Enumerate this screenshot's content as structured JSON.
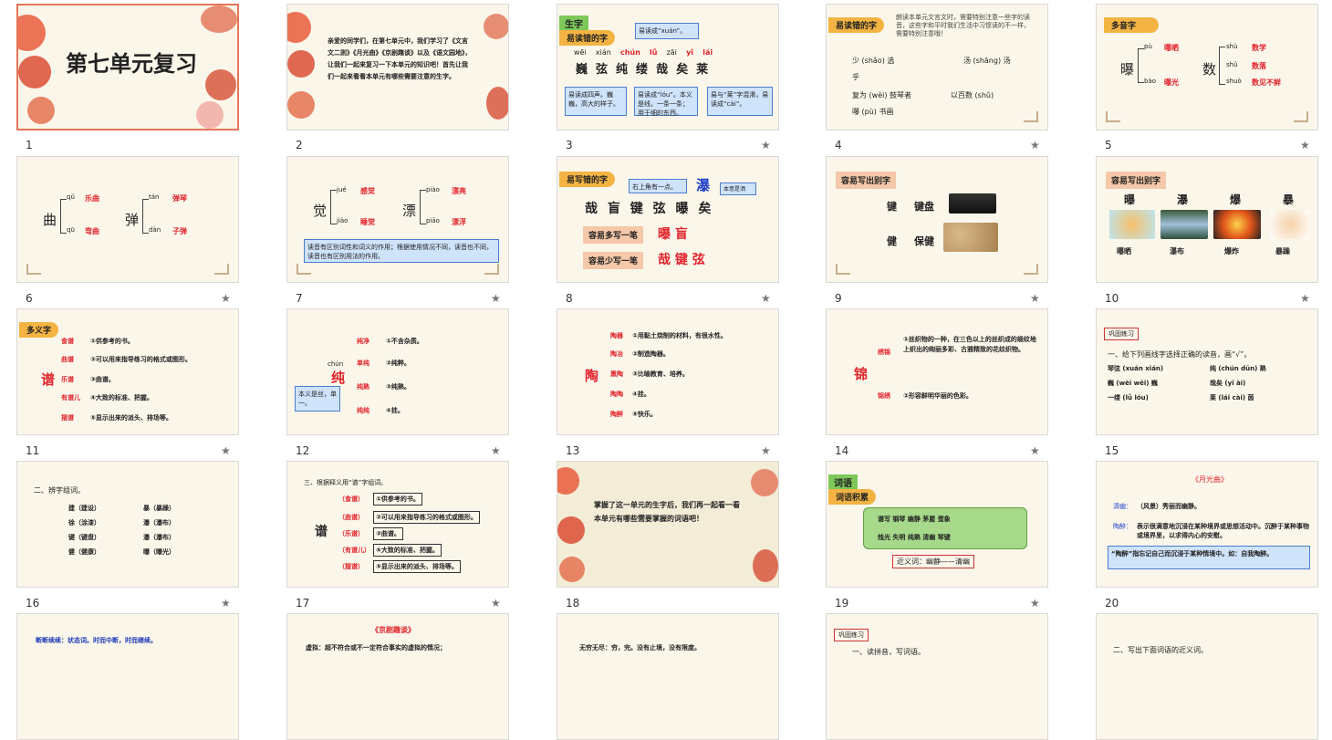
{
  "slides": {
    "s1": {
      "num": "1",
      "title": "第七单元复习"
    },
    "s2": {
      "num": "2",
      "text": "亲爱的同学们，在第七单元中，我们学习了《文言文二则》《月光曲》《京剧趣谈》以及《语文园地》，让我们一起来复习一下本单元的知识吧！首先让我们一起来看看本单元有哪些需要注意的生字。"
    },
    "s3": {
      "num": "3",
      "tag_main": "生字",
      "tag": "易读错的字",
      "callout_top": "易读成“xuán”。",
      "pinyin": [
        "wēi",
        "xián",
        "chún",
        "lǚ",
        "zāi",
        "yǐ",
        "lái"
      ],
      "chars": [
        "巍",
        "弦",
        "纯",
        "缕",
        "哉",
        "矣",
        "莱"
      ],
      "note1": "易读成四声。巍巍，高大的样子。",
      "note2": "易读成“lóu”。本义是线，一条一条；用于细的东西。",
      "note3": "易与“莱”字混淆，易读成“cài”。"
    },
    "s4": {
      "num": "4",
      "tag": "易读错的字",
      "intro": "朗读本单元文言文时，需要特别注意一些字的读音，这些字和平时我们生活中习惯读的不一样，需要特别注意哦！",
      "line1a": "少 (shǎo) 选",
      "line1b": "汤 (shāng) 汤",
      "line1c": "乎",
      "line2a": "复为 (wèi) 鼓琴者",
      "line2b": "以百数 (shǔ)",
      "line3": "曝 (pù) 书画"
    },
    "s5": {
      "num": "5",
      "tag": "多音字",
      "c1": "曝",
      "p1": "pù",
      "w1": "曝晒",
      "p2": "bào",
      "w2": "曝光",
      "c2": "数",
      "p3": "shù",
      "w3": "数学",
      "p4": "shǔ",
      "w4": "数落",
      "p5": "shuò",
      "w5": "数见不鲜"
    },
    "s6": {
      "num": "6",
      "c1": "曲",
      "p1": "qǔ",
      "w1": "乐曲",
      "p2": "qū",
      "w2": "弯曲",
      "c2": "弹",
      "p3": "tán",
      "w3": "弹琴",
      "p4": "dàn",
      "w4": "子弹"
    },
    "s7": {
      "num": "7",
      "c1": "觉",
      "p1": "jué",
      "w1": "感觉",
      "p2": "jiào",
      "w2": "睡觉",
      "c2": "漂",
      "p3": "piào",
      "w3": "漂亮",
      "p4": "piāo",
      "w4": "漂浮",
      "note": "读音有区别词性和词义的作用；根据使用情况不同，读音也不同，读音也有区别用法的作用。"
    },
    "s8": {
      "num": "8",
      "tag": "易写错的字",
      "callout": "右上角有一点。",
      "callout2": "本意是洒",
      "chars": "哉 盲 键 弦 曝 矣",
      "big": "瀑",
      "label1": "容易多写一笔",
      "ans1": "曝  盲",
      "label2": "容易少写一笔",
      "ans2": "哉  键  弦"
    },
    "s9": {
      "num": "9",
      "tag": "容易写出别字",
      "r1a": "键",
      "r1b": "键盘",
      "r2a": "健",
      "r2b": "保健"
    },
    "s10": {
      "num": "10",
      "tag": "容易写出别字",
      "chars": [
        "曝",
        "瀑",
        "爆",
        "暴"
      ],
      "words": [
        "曝晒",
        "瀑布",
        "爆炸",
        "暴躁"
      ]
    },
    "s11": {
      "num": "11",
      "tag": "多义字",
      "char": "谱",
      "items": [
        {
          "w": "食谱",
          "d": "①供参考的书。"
        },
        {
          "w": "曲谱",
          "d": "②可以用来指导练习的格式或图形。"
        },
        {
          "w": "乐谱",
          "d": "③曲谱。"
        },
        {
          "w": "有谱儿",
          "d": "④大致的标准、把握。"
        },
        {
          "w": "摆谱",
          "d": "⑤显示出来的派头、排场等。"
        }
      ]
    },
    "s12": {
      "num": "12",
      "char": "纯",
      "py": "chún",
      "note": "本义是丝，单一。",
      "items": [
        {
          "w": "纯净",
          "d": "①不含杂质。"
        },
        {
          "w": "单纯",
          "d": "②纯粹。"
        },
        {
          "w": "纯熟",
          "d": "③纯熟。"
        },
        {
          "w": "纯纯",
          "d": "④挂。"
        }
      ]
    },
    "s13": {
      "num": "13",
      "char": "陶",
      "items": [
        {
          "w": "陶器",
          "d": "①用黏土烧制的材料，有很水性。"
        },
        {
          "w": "陶冶",
          "d": "②制造陶器。"
        },
        {
          "w": "熏陶",
          "d": "③比喻教育、培养。"
        },
        {
          "w": "陶陶",
          "d": "④挂。"
        },
        {
          "w": "陶醉",
          "d": "⑤快乐。"
        }
      ]
    },
    "s14": {
      "num": "14",
      "char": "锦",
      "w1": "绣锦",
      "d1": "①丝织物的一种，在三色以上的丝织成的缎纹地上织出的绚丽多彩、古雅精致的花纹织物。",
      "w2": "锦绣",
      "d2": "②形容鲜明华丽的色彩。"
    },
    "s15": {
      "num": "15",
      "tag": "巩固练习",
      "q": "一、给下列画线字选择正确的读音，画“√”。",
      "l1a": "琴弦 (xuán xián)",
      "l1b": "纯 (chún dūn) 熟",
      "l2a": "巍 (wèi wēi) 巍",
      "l2b": "哉矣 (yǐ ài)",
      "l3a": "一缕 (lǚ lóu)",
      "l3b": "莱 (lái cài) 茵"
    },
    "s16": {
      "num": "16",
      "q": "二、辨字组词。",
      "rows": [
        [
          "建（建设）",
          "暴（暴躁）"
        ],
        [
          "徐（涂漆）",
          "瀑（瀑布）"
        ],
        [
          "键（键盘）",
          "瀑（瀑布）"
        ],
        [
          "健（健康）",
          "曝（曝光）"
        ]
      ]
    },
    "s17": {
      "num": "17",
      "q": "三、根据释义用“谱”字组词。",
      "char": "谱",
      "items": [
        {
          "w": "（食谱）",
          "d": "①供参考的书。"
        },
        {
          "w": "（曲谱）",
          "d": "②可以用来指导练习的格式或图形。"
        },
        {
          "w": "（乐谱）",
          "d": "③曲谱。"
        },
        {
          "w": "（有谱儿）",
          "d": "④大致的标准、把握。"
        },
        {
          "w": "（摆谱）",
          "d": "⑤显示出来的派头、排场等。"
        }
      ]
    },
    "s18": {
      "num": "18",
      "text": "掌握了这一单元的生字后，我们再一起看一看本单元有哪些需要掌握的词语吧！"
    },
    "s19": {
      "num": "19",
      "tag_main": "词语",
      "tag": "词语积累",
      "r1": "谱写  钢琴  幽静  茅屋  蛋象",
      "r2": "烛光  失明  纯熟  清幽  琴键",
      "near": "近义词：幽静——清幽"
    },
    "s20": {
      "num": "20",
      "title": "《月光曲》",
      "l1k": "清幽：",
      "l1": "（风景）秀丽而幽静。",
      "l2k": "陶醉：",
      "l2": "表示很满意地沉浸在某种境界或思想活动中。沉醉于某种事物或境界里，以求得内心的安慰。",
      "l3": "“陶醉”指忘记自己而沉浸于某种情境中。如：自我陶醉。"
    },
    "s21": {
      "text": "断断续续：状态词。时而中断，时而继续。"
    },
    "s22": {
      "title": "《京剧趣谈》",
      "text": "虚拟：超不符合或不一定符合事实的虚拟的情况；"
    },
    "s23": {
      "text": "无穷无尽：穷，完。没有止境，没有限度。"
    },
    "s24": {
      "tag": "巩固练习",
      "text": "一、读拼音，写词语。"
    },
    "s25": {
      "text": "二、写出下面词语的近义词。"
    }
  }
}
